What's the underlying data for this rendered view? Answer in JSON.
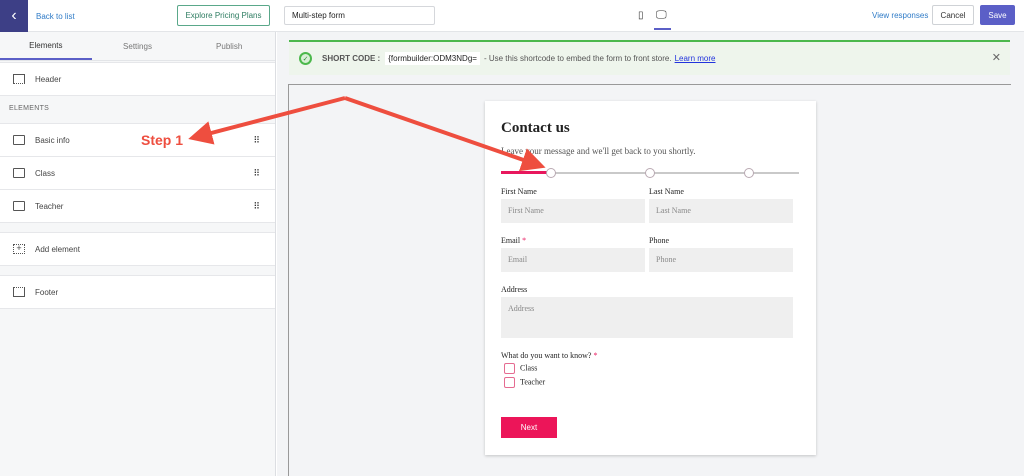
{
  "topbar": {
    "back_label": "Back to list",
    "pricing_label": "Explore Pricing Plans",
    "form_name": "Multi-step form",
    "view_responses": "View responses",
    "cancel": "Cancel",
    "save": "Save"
  },
  "sidebar": {
    "tabs": [
      "Elements",
      "Settings",
      "Publish"
    ],
    "header": "Header",
    "section_label": "ELEMENTS",
    "items": [
      {
        "label": "Basic info"
      },
      {
        "label": "Class"
      },
      {
        "label": "Teacher"
      }
    ],
    "add_element": "Add element",
    "footer": "Footer"
  },
  "banner": {
    "label": "SHORT CODE :",
    "code": "{formbuilder:ODM3NDg=",
    "text": "- Use this shortcode to embed the form to front store.",
    "link": "Learn more"
  },
  "form": {
    "title": "Contact us",
    "subtitle": "Leave your message and we'll get back to you shortly.",
    "progress_step": 1,
    "total_steps": 4,
    "fields": {
      "first_name": {
        "label": "First Name",
        "placeholder": "First Name"
      },
      "last_name": {
        "label": "Last Name",
        "placeholder": "Last Name"
      },
      "email": {
        "label": "Email",
        "placeholder": "Email"
      },
      "phone": {
        "label": "Phone",
        "placeholder": "Phone"
      },
      "address": {
        "label": "Address",
        "placeholder": "Address"
      }
    },
    "question": "What do you want to know?",
    "required_mark": "*",
    "options": [
      "Class",
      "Teacher"
    ],
    "next": "Next"
  },
  "annotation": {
    "label": "Step 1",
    "color": "#ee4e3f"
  },
  "colors": {
    "accent": "#5b5fc7",
    "form_accent": "#ec1559",
    "success": "#4cb84c"
  }
}
